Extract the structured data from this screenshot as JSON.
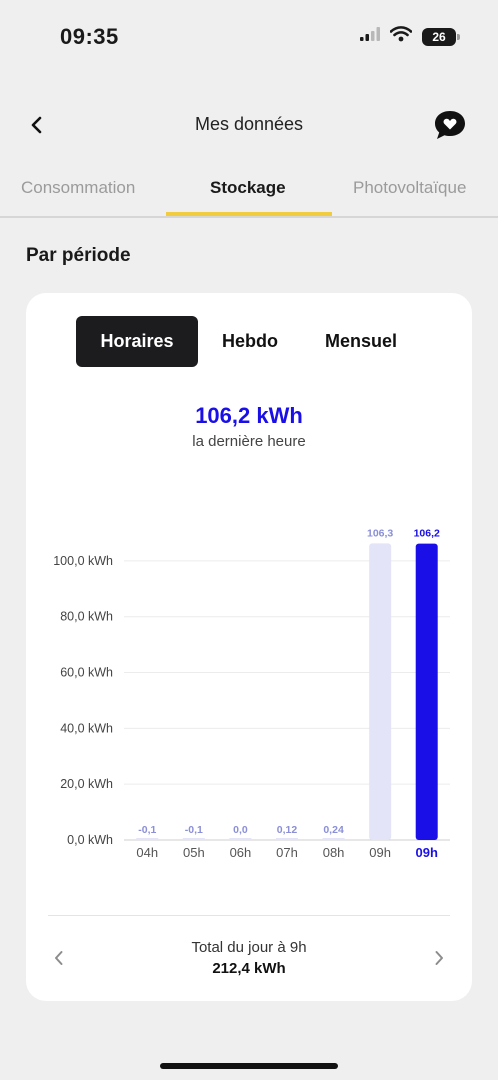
{
  "status_bar": {
    "time": "09:35",
    "battery": "26",
    "icons": [
      "signal-icon",
      "wifi-icon",
      "battery-icon"
    ]
  },
  "nav": {
    "title": "Mes données",
    "icons": [
      "back-icon",
      "chat-heart-icon"
    ]
  },
  "tabs": [
    {
      "label": "Consommation",
      "active": false
    },
    {
      "label": "Stockage",
      "active": true
    },
    {
      "label": "Photovoltaïque",
      "active": false
    }
  ],
  "section_title": "Par période",
  "period_tabs": [
    {
      "label": "Horaires",
      "active": true
    },
    {
      "label": "Hebdo",
      "active": false
    },
    {
      "label": "Mensuel",
      "active": false
    }
  ],
  "summary": {
    "value": "106,2 kWh",
    "label": "la dernière heure"
  },
  "colors": {
    "accent": "#1a0fe6",
    "bar_light": "#e3e4f8",
    "label_light": "#8a8fd6",
    "tab_underline": "#f2cc3f"
  },
  "chart_data": {
    "type": "bar",
    "categories": [
      "04h",
      "05h",
      "06h",
      "07h",
      "08h",
      "09h",
      "09h"
    ],
    "values": [
      -0.1,
      -0.1,
      0.0,
      0.12,
      0.24,
      106.3,
      106.2
    ],
    "value_labels": [
      "-0,1",
      "-0,1",
      "0,0",
      "0,12",
      "0,24",
      "106,3",
      "106,2"
    ],
    "highlight_index": 6,
    "y_ticks": [
      {
        "value": 0,
        "label": "0,0 kWh"
      },
      {
        "value": 20,
        "label": "20,0 kWh"
      },
      {
        "value": 40,
        "label": "40,0 kWh"
      },
      {
        "value": 60,
        "label": "60,0 kWh"
      },
      {
        "value": 80,
        "label": "80,0 kWh"
      },
      {
        "value": 100,
        "label": "100,0 kWh"
      }
    ],
    "ylim": [
      0,
      110
    ],
    "grid": true
  },
  "footer": {
    "label": "Total du jour à 9h",
    "value": "212,4 kWh",
    "icons": [
      "chevron-left-icon",
      "chevron-right-icon"
    ]
  }
}
